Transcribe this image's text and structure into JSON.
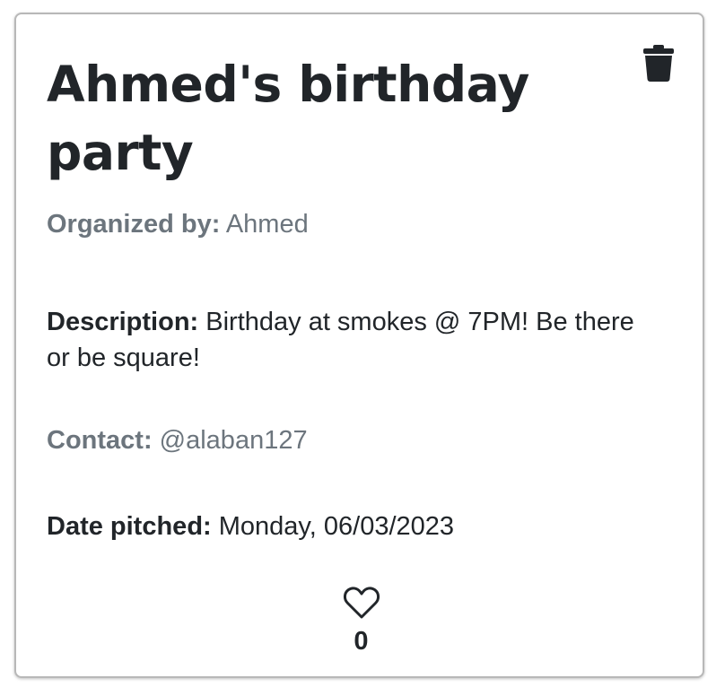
{
  "event": {
    "title": "Ahmed's birthday party",
    "organizer_label": "Organized by:",
    "organizer_value": "Ahmed",
    "description_label": "Description:",
    "description_value": "Birthday at smokes @ 7PM! Be there or be square!",
    "contact_label": "Contact:",
    "contact_value": "@alaban127",
    "date_label": "Date pitched:",
    "date_value": "Monday, 06/03/2023",
    "like_count": "0"
  },
  "icons": {
    "delete": "trash-icon",
    "like": "heart-outline-icon"
  },
  "colors": {
    "text": "#212529",
    "muted": "#6c757d",
    "border": "#b8b8b8"
  }
}
